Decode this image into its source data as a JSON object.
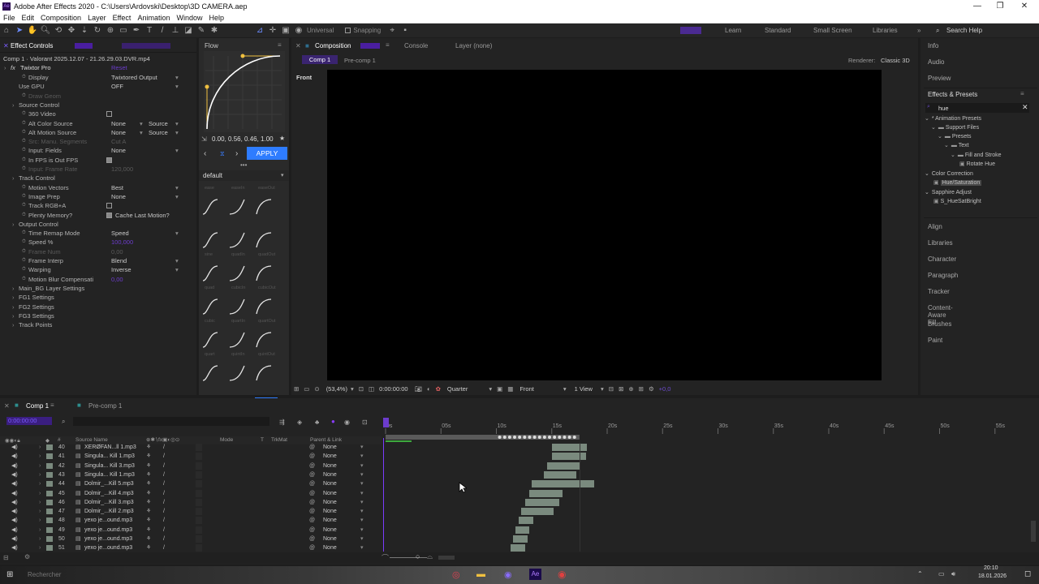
{
  "window": {
    "title": "Adobe After Effects 2020 - C:\\Users\\Ardovski\\Desktop\\3D CAMERA.aep",
    "app_icon": "Ae",
    "controls": [
      "—",
      "❐",
      "✕"
    ]
  },
  "menu": [
    "File",
    "Edit",
    "Composition",
    "Layer",
    "Effect",
    "Animation",
    "Window",
    "Help"
  ],
  "toolbar": {
    "universal_label": "Universal",
    "snapping_label": "Snapping",
    "workspaces": [
      "Learn",
      "Standard",
      "Small Screen",
      "Libraries"
    ],
    "search_placeholder": "Search Help",
    "expand_glyph": "»"
  },
  "effect_controls": {
    "tab": "Effect Controls",
    "layer_path": "Comp 1 · Valorant 2025.12.07 - 21.26.29.03.DVR.mp4",
    "effect_name": "Twixtor Pro",
    "rows": [
      {
        "label": "Display",
        "value": "Twixtored Output",
        "indent": 2
      },
      {
        "label": "Use GPU",
        "value": "OFF",
        "indent": 1
      },
      {
        "label": "Draw Geom",
        "value": "",
        "indent": 2,
        "dim": true
      },
      {
        "label": "Source Control",
        "value": "",
        "indent": 1,
        "section": true
      },
      {
        "label": "360 Video",
        "value": "",
        "indent": 2,
        "checkbox": false
      },
      {
        "label": "Alt Color Source",
        "value": "None",
        "value2": "Source",
        "indent": 2
      },
      {
        "label": "Alt Motion Source",
        "value": "None",
        "value2": "Source",
        "indent": 2
      },
      {
        "label": "Src: Manu. Segments",
        "value": "Cut A",
        "indent": 2,
        "dim": true
      },
      {
        "label": "Input: Fields",
        "value": "None",
        "indent": 2
      },
      {
        "label": "In FPS is Out FPS",
        "value": "",
        "indent": 2,
        "checkbox": true
      },
      {
        "label": "Input: Frame Rate",
        "value": "120,000",
        "indent": 2,
        "dim": true
      },
      {
        "label": "Track Control",
        "value": "",
        "indent": 1,
        "section": true
      },
      {
        "label": "Motion Vectors",
        "value": "Best",
        "indent": 2
      },
      {
        "label": "Image Prep",
        "value": "None",
        "indent": 2
      },
      {
        "label": "Track RGB+A",
        "value": "",
        "indent": 2,
        "checkbox": false
      },
      {
        "label": "Plenty Memory?",
        "value": "Cache Last Motion?",
        "indent": 2,
        "checkbox": true
      },
      {
        "label": "Output Control",
        "value": "",
        "indent": 1,
        "section": true
      },
      {
        "label": "Time Remap Mode",
        "value": "Speed",
        "indent": 2
      },
      {
        "label": "Speed %",
        "value": "100,000",
        "indent": 2,
        "accent": true
      },
      {
        "label": "Frame Num",
        "value": "0,00",
        "indent": 2,
        "dim": true
      },
      {
        "label": "Frame Interp",
        "value": "Blend",
        "indent": 2
      },
      {
        "label": "Warping",
        "value": "Inverse",
        "indent": 2
      },
      {
        "label": "Motion Blur Compensati",
        "value": "0,00",
        "indent": 2,
        "accent": true
      },
      {
        "label": "Main_BG Layer Settings",
        "value": "",
        "indent": 1,
        "section": true
      },
      {
        "label": "FG1 Settings",
        "value": "",
        "indent": 1,
        "section": true
      },
      {
        "label": "FG2 Settings",
        "value": "",
        "indent": 1,
        "section": true
      },
      {
        "label": "FG3 Settings",
        "value": "",
        "indent": 1,
        "section": true
      },
      {
        "label": "Track Points",
        "value": "",
        "indent": 1,
        "section": true
      }
    ]
  },
  "flow": {
    "tab": "Flow",
    "bezier_values": "0.00, 0.56, 0.46, 1.00",
    "apply_label": "APPLY",
    "preset_group": "default",
    "curve_labels": [
      [
        "ease",
        "easeIn",
        "easeOut"
      ],
      [
        "sine",
        "quadIn",
        "quadOut"
      ],
      [
        "quad",
        "cubicIn",
        "cubicOut"
      ],
      [
        "cubic",
        "quartIn",
        "quartOut"
      ],
      [
        "quart",
        "quintIn",
        "quintOut"
      ],
      [
        "quint",
        "expoIn",
        "expoOut"
      ],
      [
        "expo",
        "",
        ""
      ]
    ]
  },
  "composition": {
    "tabs": [
      "Composition",
      "Console",
      "Layer (none)"
    ],
    "comp_label": "Comp 1",
    "subtabs": [
      "Comp 1",
      "Pre-comp 1"
    ],
    "renderer_label": "Renderer:",
    "renderer_value": "Classic 3D",
    "view_label": "Front",
    "zoom": "(53,4%)",
    "timecode": "0:00:00:00",
    "resolution": "Quarter",
    "camera": "Front",
    "views": "1 View",
    "offset": "+0,0"
  },
  "right_panel": {
    "items_top": [
      "Info",
      "Audio",
      "Preview"
    ],
    "effects_title": "Effects & Presets",
    "search_value": "hue",
    "tree": [
      {
        "label": "* Animation Presets",
        "level": 0,
        "type": "folder"
      },
      {
        "label": "Support Files",
        "level": 1,
        "type": "folder"
      },
      {
        "label": "Presets",
        "level": 2,
        "type": "folder"
      },
      {
        "label": "Text",
        "level": 3,
        "type": "folder"
      },
      {
        "label": "Fill and Stroke",
        "level": 4,
        "type": "folder"
      },
      {
        "label": "Rotate Hue",
        "level": 5,
        "type": "preset"
      },
      {
        "label": "Color Correction",
        "level": 0,
        "type": "category"
      },
      {
        "label": "Hue/Saturation",
        "level": 1,
        "type": "effect",
        "selected": true
      },
      {
        "label": "Sapphire Adjust",
        "level": 0,
        "type": "category"
      },
      {
        "label": "S_HueSatBright",
        "level": 1,
        "type": "effect"
      }
    ],
    "items_bottom": [
      "Align",
      "Libraries",
      "Character",
      "Paragraph",
      "Tracker",
      "Content-Aware Fill",
      "Brushes",
      "Paint"
    ]
  },
  "timeline": {
    "tabs": [
      "Comp 1",
      "Pre-comp 1"
    ],
    "timecode": "0:00:00:00",
    "columns": [
      "#",
      "Source Name",
      "Mode",
      "T",
      "TrkMat",
      "Parent & Link"
    ],
    "ruler": [
      "0s",
      "05s",
      "10s",
      "15s",
      "20s",
      "25s",
      "30s",
      "35s",
      "40s",
      "45s",
      "50s",
      "55s"
    ],
    "layers": [
      {
        "num": "40",
        "name": "XERØFAN...ll 1.mp3",
        "parent": "None",
        "bar_start": 15.0,
        "bar_end": 18.2
      },
      {
        "num": "41",
        "name": "Singula... Kill 1.mp3",
        "parent": "None",
        "bar_start": 15.0,
        "bar_end": 18.1
      },
      {
        "num": "42",
        "name": "Singula... Kill 3.mp3",
        "parent": "None",
        "bar_start": 14.6,
        "bar_end": 17.6
      },
      {
        "num": "43",
        "name": "Singula... Kill 1.mp3",
        "parent": "None",
        "bar_start": 14.3,
        "bar_end": 17.2
      },
      {
        "num": "44",
        "name": "Dolmir_...Kill 5.mp3",
        "parent": "None",
        "bar_start": 13.2,
        "bar_end": 18.8
      },
      {
        "num": "45",
        "name": "Dolmir_...Kill 4.mp3",
        "parent": "None",
        "bar_start": 13.0,
        "bar_end": 16.0
      },
      {
        "num": "46",
        "name": "Dolmir_...Kill 3.mp3",
        "parent": "None",
        "bar_start": 12.6,
        "bar_end": 15.7
      },
      {
        "num": "47",
        "name": "Dolmir_...Kill 2.mp3",
        "parent": "None",
        "bar_start": 12.2,
        "bar_end": 15.2
      },
      {
        "num": "48",
        "name": "yexo je...ound.mp3",
        "parent": "None",
        "bar_start": 12.0,
        "bar_end": 13.3
      },
      {
        "num": "49",
        "name": "yexo je...ound.mp3",
        "parent": "None",
        "bar_start": 11.7,
        "bar_end": 13.0
      },
      {
        "num": "50",
        "name": "yexo je...ound.mp3",
        "parent": "None",
        "bar_start": 11.5,
        "bar_end": 12.8
      },
      {
        "num": "51",
        "name": "yexo je...ound.mp3",
        "parent": "None",
        "bar_start": 11.3,
        "bar_end": 12.6
      }
    ],
    "work_area_end_s": 17.5
  },
  "taskbar": {
    "search_placeholder": "Rechercher",
    "time": "20:10",
    "date": "18.01.2026"
  },
  "colors": {
    "accent": "#7a3cff",
    "blue": "#2e7cff",
    "bar": "#7a8a7e",
    "curve": "#f0c040"
  }
}
